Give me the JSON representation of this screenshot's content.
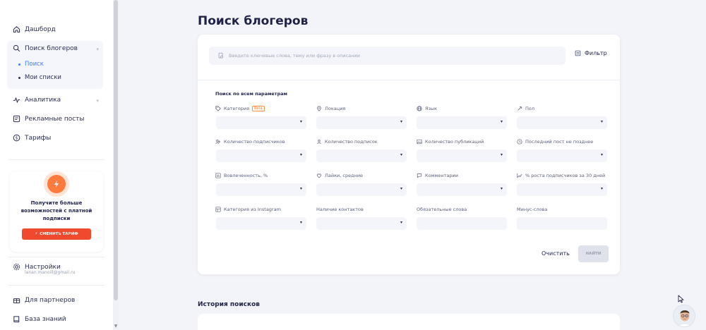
{
  "sidebar": {
    "items": [
      {
        "label": "Дашборд",
        "icon": "home-icon"
      },
      {
        "label": "Поиск блогеров",
        "icon": "search-icon"
      },
      {
        "label": "Аналитика",
        "icon": "analytics-icon"
      },
      {
        "label": "Рекламные посты",
        "icon": "posts-icon"
      },
      {
        "label": "Тарифы",
        "icon": "dollar-icon"
      }
    ],
    "subitems": [
      {
        "label": "Поиск",
        "active": true
      },
      {
        "label": "Мои списки",
        "active": false
      }
    ],
    "promo": {
      "text": "Получите больше возможностей с платной подписки",
      "button": "СМЕНИТЬ ТАРИФ",
      "icon": "lightning-icon",
      "accent": "#ff7a3d"
    },
    "settings": {
      "label": "Настройки",
      "email": "lanan.manoill@gmail.ru",
      "icon": "gear-icon"
    },
    "bottom_items": [
      {
        "label": "Для партнеров",
        "icon": "gift-icon"
      },
      {
        "label": "База знаний",
        "icon": "book-icon"
      }
    ]
  },
  "main": {
    "title": "Поиск блогеров",
    "search": {
      "placeholder": "Введите ключевые слова, тему или фразу в описании",
      "icon": "search-doc-icon"
    },
    "filter_label": "Фильтр",
    "section_title": "Поиск по всем параметрам",
    "fields": [
      {
        "label": "Категория",
        "badge": "Beta",
        "icon": "tag-icon",
        "dropdown": true
      },
      {
        "label": "Локация",
        "icon": "location-icon",
        "dropdown": true
      },
      {
        "label": "Язык",
        "icon": "globe-icon",
        "dropdown": true
      },
      {
        "label": "Пол",
        "icon": "gender-icon",
        "dropdown": true
      },
      {
        "label": "Количество подписчиков",
        "icon": "followers-icon",
        "dropdown": true
      },
      {
        "label": "Количество подписок",
        "icon": "following-icon",
        "dropdown": true
      },
      {
        "label": "Количество публикаций",
        "icon": "image-icon",
        "dropdown": true
      },
      {
        "label": "Последний пост не позднее",
        "icon": "clock-icon",
        "dropdown": true
      },
      {
        "label": "Вовлеченность, %",
        "icon": "engagement-icon",
        "dropdown": true
      },
      {
        "label": "Лайки, средние",
        "icon": "heart-icon",
        "dropdown": true
      },
      {
        "label": "Комментарии",
        "icon": "comment-icon",
        "dropdown": true
      },
      {
        "label": "% роста подписчиков за 30 дней",
        "icon": "growth-icon",
        "dropdown": true
      },
      {
        "label": "Категория из Instagram",
        "icon": "instagram-category-icon",
        "dropdown": true
      },
      {
        "label": "Наличие контактов",
        "icon": "",
        "dropdown": true
      },
      {
        "label": "Обязательные слова",
        "icon": "",
        "dropdown": false
      },
      {
        "label": "Минус-слова",
        "icon": "",
        "dropdown": false
      }
    ],
    "clear_label": "Очистить",
    "find_label": "НАЙТИ",
    "history_title": "История поисков"
  },
  "colors": {
    "accent": "#3d7df6",
    "orange": "#ff7a3d",
    "red_button": "#f0492e",
    "text": "#1e2247"
  }
}
